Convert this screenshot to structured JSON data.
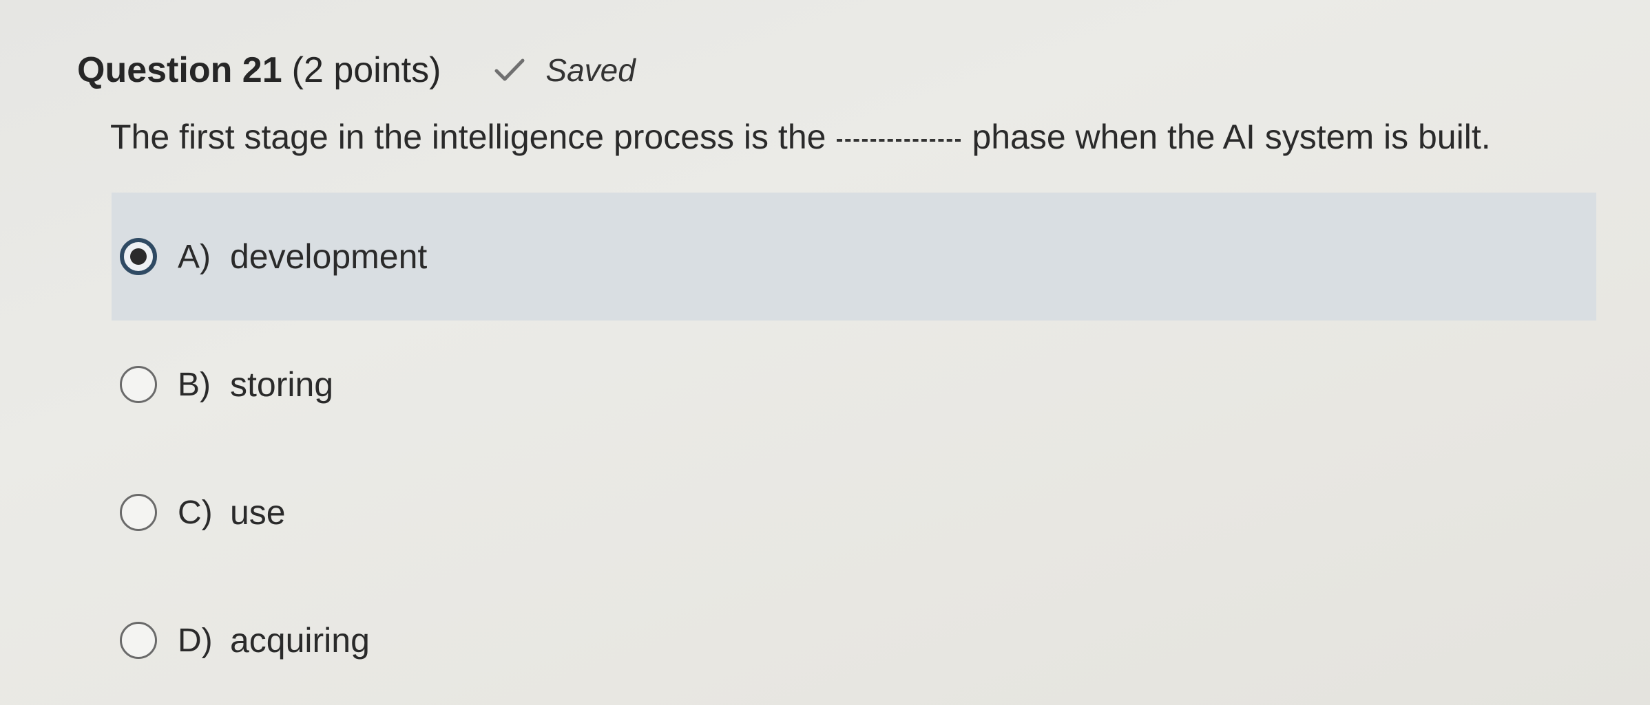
{
  "question": {
    "number_label": "Question 21",
    "points_label": "(2 points)",
    "status_text": "Saved",
    "prompt_before": "The first stage in the intelligence process is the",
    "prompt_after": "phase when the AI system is built."
  },
  "options": [
    {
      "letter": "A)",
      "text": "development",
      "selected": true
    },
    {
      "letter": "B)",
      "text": "storing",
      "selected": false
    },
    {
      "letter": "C)",
      "text": "use",
      "selected": false
    },
    {
      "letter": "D)",
      "text": "acquiring",
      "selected": false
    }
  ],
  "colors": {
    "selected_background": "#d9dee2",
    "radio_selected_ring": "#2f4a63",
    "text": "#2a2a2a",
    "page_background": "#e8e8e4"
  },
  "icons": {
    "saved": "check-icon"
  }
}
